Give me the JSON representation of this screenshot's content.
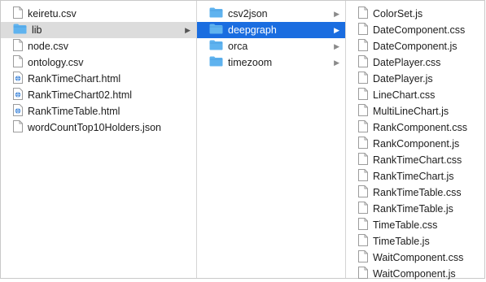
{
  "col1": [
    {
      "label": "keiretu.csv",
      "kind": "file"
    },
    {
      "label": "lib",
      "kind": "folder",
      "state": "gray"
    },
    {
      "label": "node.csv",
      "kind": "file"
    },
    {
      "label": "ontology.csv",
      "kind": "file"
    },
    {
      "label": "RankTimeChart.html",
      "kind": "html"
    },
    {
      "label": "RankTimeChart02.html",
      "kind": "html"
    },
    {
      "label": "RankTimeTable.html",
      "kind": "html"
    },
    {
      "label": "wordCountTop10Holders.json",
      "kind": "file"
    }
  ],
  "col2": [
    {
      "label": "csv2json",
      "kind": "folder"
    },
    {
      "label": "deepgraph",
      "kind": "folder",
      "state": "blue"
    },
    {
      "label": "orca",
      "kind": "folder"
    },
    {
      "label": "timezoom",
      "kind": "folder"
    }
  ],
  "col3": [
    {
      "label": "ColorSet.js"
    },
    {
      "label": "DateComponent.css"
    },
    {
      "label": "DateComponent.js"
    },
    {
      "label": "DatePlayer.css"
    },
    {
      "label": "DatePlayer.js"
    },
    {
      "label": "LineChart.css"
    },
    {
      "label": "MultiLineChart.js"
    },
    {
      "label": "RankComponent.css"
    },
    {
      "label": "RankComponent.js"
    },
    {
      "label": "RankTimeChart.css"
    },
    {
      "label": "RankTimeChart.js"
    },
    {
      "label": "RankTimeTable.css"
    },
    {
      "label": "RankTimeTable.js"
    },
    {
      "label": "TimeTable.css"
    },
    {
      "label": "TimeTable.js"
    },
    {
      "label": "WaitComponent.css"
    },
    {
      "label": "WaitComponent.js"
    }
  ],
  "arrow_glyph": "▶",
  "colors": {
    "selection_blue": "#1a6de0",
    "selection_gray": "#dcdcdc",
    "folder": "#5fb3ef"
  }
}
